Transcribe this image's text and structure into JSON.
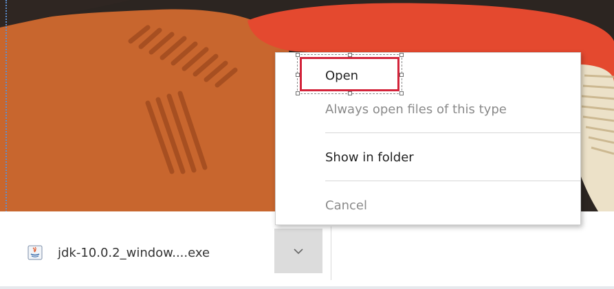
{
  "download_shelf": {
    "file_name": "jdk-10.0.2_window....exe",
    "file_icon": "java-installer-icon",
    "dropdown_icon": "chevron-down-icon"
  },
  "context_menu": {
    "open_label": "Open",
    "always_open_label": "Always open files of this type",
    "show_in_folder_label": "Show in folder",
    "cancel_label": "Cancel"
  },
  "annotation": {
    "highlight_target": "Open",
    "highlight_color": "#d3233a"
  },
  "colors": {
    "bg_orange": "#c8662e",
    "bg_red": "#e4492f",
    "bg_cream": "#ece1c8",
    "bg_dark": "#2c2521"
  }
}
